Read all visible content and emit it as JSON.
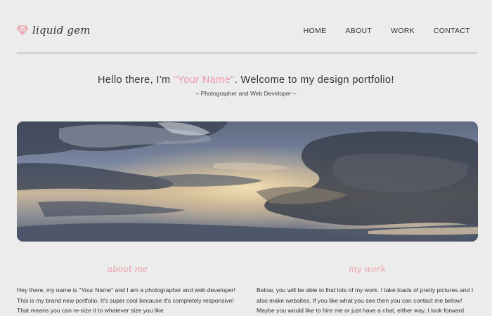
{
  "brand": {
    "logo_text": "liquid gem",
    "accent": "#ec9aa6"
  },
  "nav": {
    "items": [
      {
        "label": "HOME"
      },
      {
        "label": "ABOUT"
      },
      {
        "label": "WORK"
      },
      {
        "label": "CONTACT"
      }
    ]
  },
  "intro": {
    "heading_prefix": "Hello there, I'm ",
    "heading_name": "\"Your Name\"",
    "heading_suffix": ". Welcome to my design portfolio!",
    "tagline": "– Photographer and Web Developer –"
  },
  "sections": {
    "about": {
      "title": "about me",
      "body": "Hey there, my name is \"Your Name\" and I am a photographer and web developer! This is my brand new portfolio. It's super cool because it's completely responsive! That means you can re-size it to whatever size you like"
    },
    "work": {
      "title": "my work",
      "body": "Below, you will be able to find lots of my work. I take loads of pretty pictures and I also make websites. If you like what you see then you can contact me below! Maybe you would like to hire me or just have a chat, either way, I look forward"
    }
  }
}
